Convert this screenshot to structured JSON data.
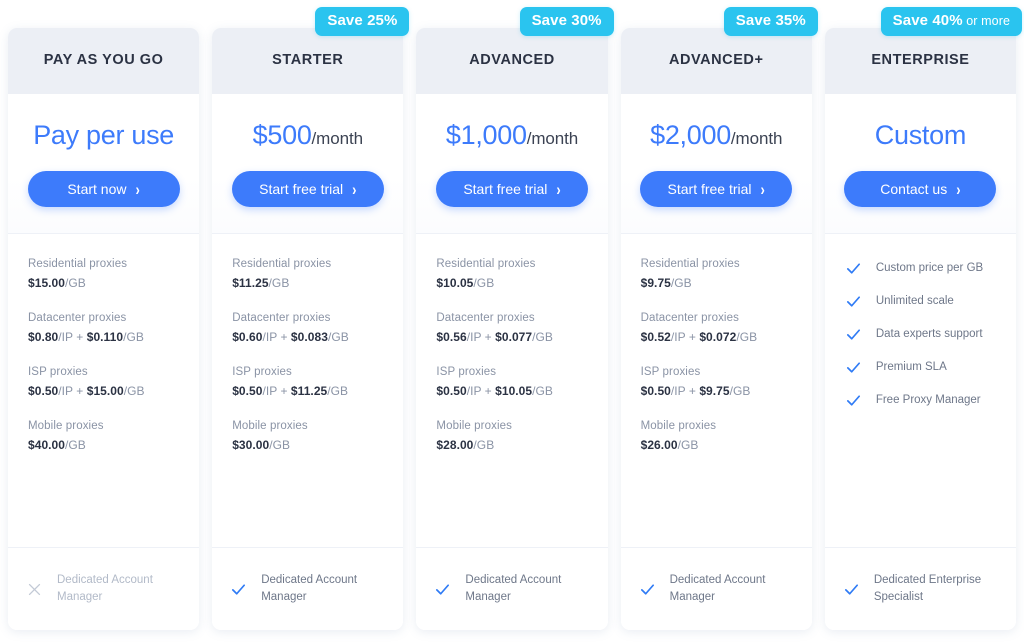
{
  "colors": {
    "accent_blue": "#3d7bfb",
    "badge_cyan": "#2ac4ef",
    "header_band": "#eceff5",
    "text_dark": "#2b3243",
    "text_muted": "#8a93a5",
    "text_disabled": "#b2bac8"
  },
  "plans": [
    {
      "name": "PAY AS YOU GO",
      "badge": null,
      "badge_suffix": null,
      "price_main": "Pay per use",
      "price_period": "",
      "cta_label": "Start now",
      "features_type": "proxy-prices",
      "proxies": [
        {
          "label": "Residential proxies",
          "price_html": "<b>$15.00</b><span class=\"unit\">/GB</span>"
        },
        {
          "label": "Datacenter proxies",
          "price_html": "<b>$0.80</b><span class=\"unit\">/IP + </span><b>$0.110</b><span class=\"unit\">/GB</span>"
        },
        {
          "label": "ISP proxies",
          "price_html": "<b>$0.50</b><span class=\"unit\">/IP + </span><b>$15.00</b><span class=\"unit\">/GB</span>"
        },
        {
          "label": "Mobile proxies",
          "price_html": "<b>$40.00</b><span class=\"unit\">/GB</span>"
        }
      ],
      "bullets": [],
      "footer_icon": "x-icon",
      "footer_label": "Dedicated Account Manager",
      "footer_muted": true
    },
    {
      "name": "STARTER",
      "badge": "Save 25%",
      "badge_suffix": null,
      "price_main": "$500",
      "price_period": "/month",
      "cta_label": "Start free trial",
      "features_type": "proxy-prices",
      "proxies": [
        {
          "label": "Residential proxies",
          "price_html": "<b>$11.25</b><span class=\"unit\">/GB</span>"
        },
        {
          "label": "Datacenter proxies",
          "price_html": "<b>$0.60</b><span class=\"unit\">/IP + </span><b>$0.083</b><span class=\"unit\">/GB</span>"
        },
        {
          "label": "ISP proxies",
          "price_html": "<b>$0.50</b><span class=\"unit\">/IP + </span><b>$11.25</b><span class=\"unit\">/GB</span>"
        },
        {
          "label": "Mobile proxies",
          "price_html": "<b>$30.00</b><span class=\"unit\">/GB</span>"
        }
      ],
      "bullets": [],
      "footer_icon": "check-icon",
      "footer_label": "Dedicated Account Manager",
      "footer_muted": false
    },
    {
      "name": "ADVANCED",
      "badge": "Save 30%",
      "badge_suffix": null,
      "price_main": "$1,000",
      "price_period": "/month",
      "cta_label": "Start free trial",
      "features_type": "proxy-prices",
      "proxies": [
        {
          "label": "Residential proxies",
          "price_html": "<b>$10.05</b><span class=\"unit\">/GB</span>"
        },
        {
          "label": "Datacenter proxies",
          "price_html": "<b>$0.56</b><span class=\"unit\">/IP + </span><b>$0.077</b><span class=\"unit\">/GB</span>"
        },
        {
          "label": "ISP proxies",
          "price_html": "<b>$0.50</b><span class=\"unit\">/IP + </span><b>$10.05</b><span class=\"unit\">/GB</span>"
        },
        {
          "label": "Mobile proxies",
          "price_html": "<b>$28.00</b><span class=\"unit\">/GB</span>"
        }
      ],
      "bullets": [],
      "footer_icon": "check-icon",
      "footer_label": "Dedicated Account Manager",
      "footer_muted": false
    },
    {
      "name": "ADVANCED+",
      "badge": "Save 35%",
      "badge_suffix": null,
      "price_main": "$2,000",
      "price_period": "/month",
      "cta_label": "Start free trial",
      "features_type": "proxy-prices",
      "proxies": [
        {
          "label": "Residential proxies",
          "price_html": "<b>$9.75</b><span class=\"unit\">/GB</span>"
        },
        {
          "label": "Datacenter proxies",
          "price_html": "<b>$0.52</b><span class=\"unit\">/IP + </span><b>$0.072</b><span class=\"unit\">/GB</span>"
        },
        {
          "label": "ISP proxies",
          "price_html": "<b>$0.50</b><span class=\"unit\">/IP + </span><b>$9.75</b><span class=\"unit\">/GB</span>"
        },
        {
          "label": "Mobile proxies",
          "price_html": "<b>$26.00</b><span class=\"unit\">/GB</span>"
        }
      ],
      "bullets": [],
      "footer_icon": "check-icon",
      "footer_label": "Dedicated Account Manager",
      "footer_muted": false
    },
    {
      "name": "ENTERPRISE",
      "badge": "Save 40%",
      "badge_suffix": " or more",
      "price_main": "Custom",
      "price_period": "",
      "cta_label": "Contact us",
      "features_type": "bullets",
      "proxies": [],
      "bullets": [
        "Custom price per GB",
        "Unlimited scale",
        "Data experts support",
        "Premium SLA",
        "Free Proxy Manager"
      ],
      "footer_icon": "check-icon",
      "footer_label": "Dedicated Enterprise Specialist",
      "footer_muted": false
    }
  ]
}
